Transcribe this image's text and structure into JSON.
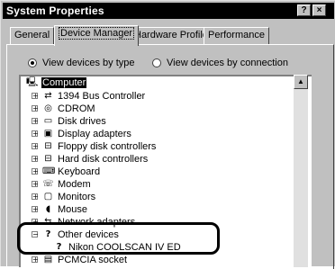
{
  "window": {
    "title": "System Properties",
    "help_btn": "?",
    "close_btn": "×"
  },
  "tabs": [
    {
      "label": "General"
    },
    {
      "label": "Device Manager"
    },
    {
      "label": "Hardware Profiles"
    },
    {
      "label": "Performance"
    }
  ],
  "view_options": {
    "by_type": "View devices by type",
    "by_connection": "View devices by connection",
    "selected": "by_type"
  },
  "tree": {
    "root": "Computer",
    "items": [
      {
        "label": "1394 Bus Controller",
        "icon": "bus-controller-icon",
        "expander": "+"
      },
      {
        "label": "CDROM",
        "icon": "cdrom-icon",
        "expander": "+"
      },
      {
        "label": "Disk drives",
        "icon": "disk-drive-icon",
        "expander": "+"
      },
      {
        "label": "Display adapters",
        "icon": "display-adapter-icon",
        "expander": "+"
      },
      {
        "label": "Floppy disk controllers",
        "icon": "floppy-controller-icon",
        "expander": "+"
      },
      {
        "label": "Hard disk controllers",
        "icon": "hard-disk-controller-icon",
        "expander": "+"
      },
      {
        "label": "Keyboard",
        "icon": "keyboard-icon",
        "expander": "+"
      },
      {
        "label": "Modem",
        "icon": "modem-icon",
        "expander": "+"
      },
      {
        "label": "Monitors",
        "icon": "monitor-icon",
        "expander": "+"
      },
      {
        "label": "Mouse",
        "icon": "mouse-icon",
        "expander": "+"
      },
      {
        "label": "Network adapters",
        "icon": "network-adapter-icon",
        "expander": "+"
      },
      {
        "label": "Other devices",
        "icon": "question-icon",
        "expander": "−"
      },
      {
        "label": "Nikon COOLSCAN IV ED",
        "icon": "question-icon",
        "expander": ""
      },
      {
        "label": "PCMCIA socket",
        "icon": "pcmcia-icon",
        "expander": "+"
      }
    ]
  },
  "scrollbar": {
    "up_arrow": "▲"
  }
}
